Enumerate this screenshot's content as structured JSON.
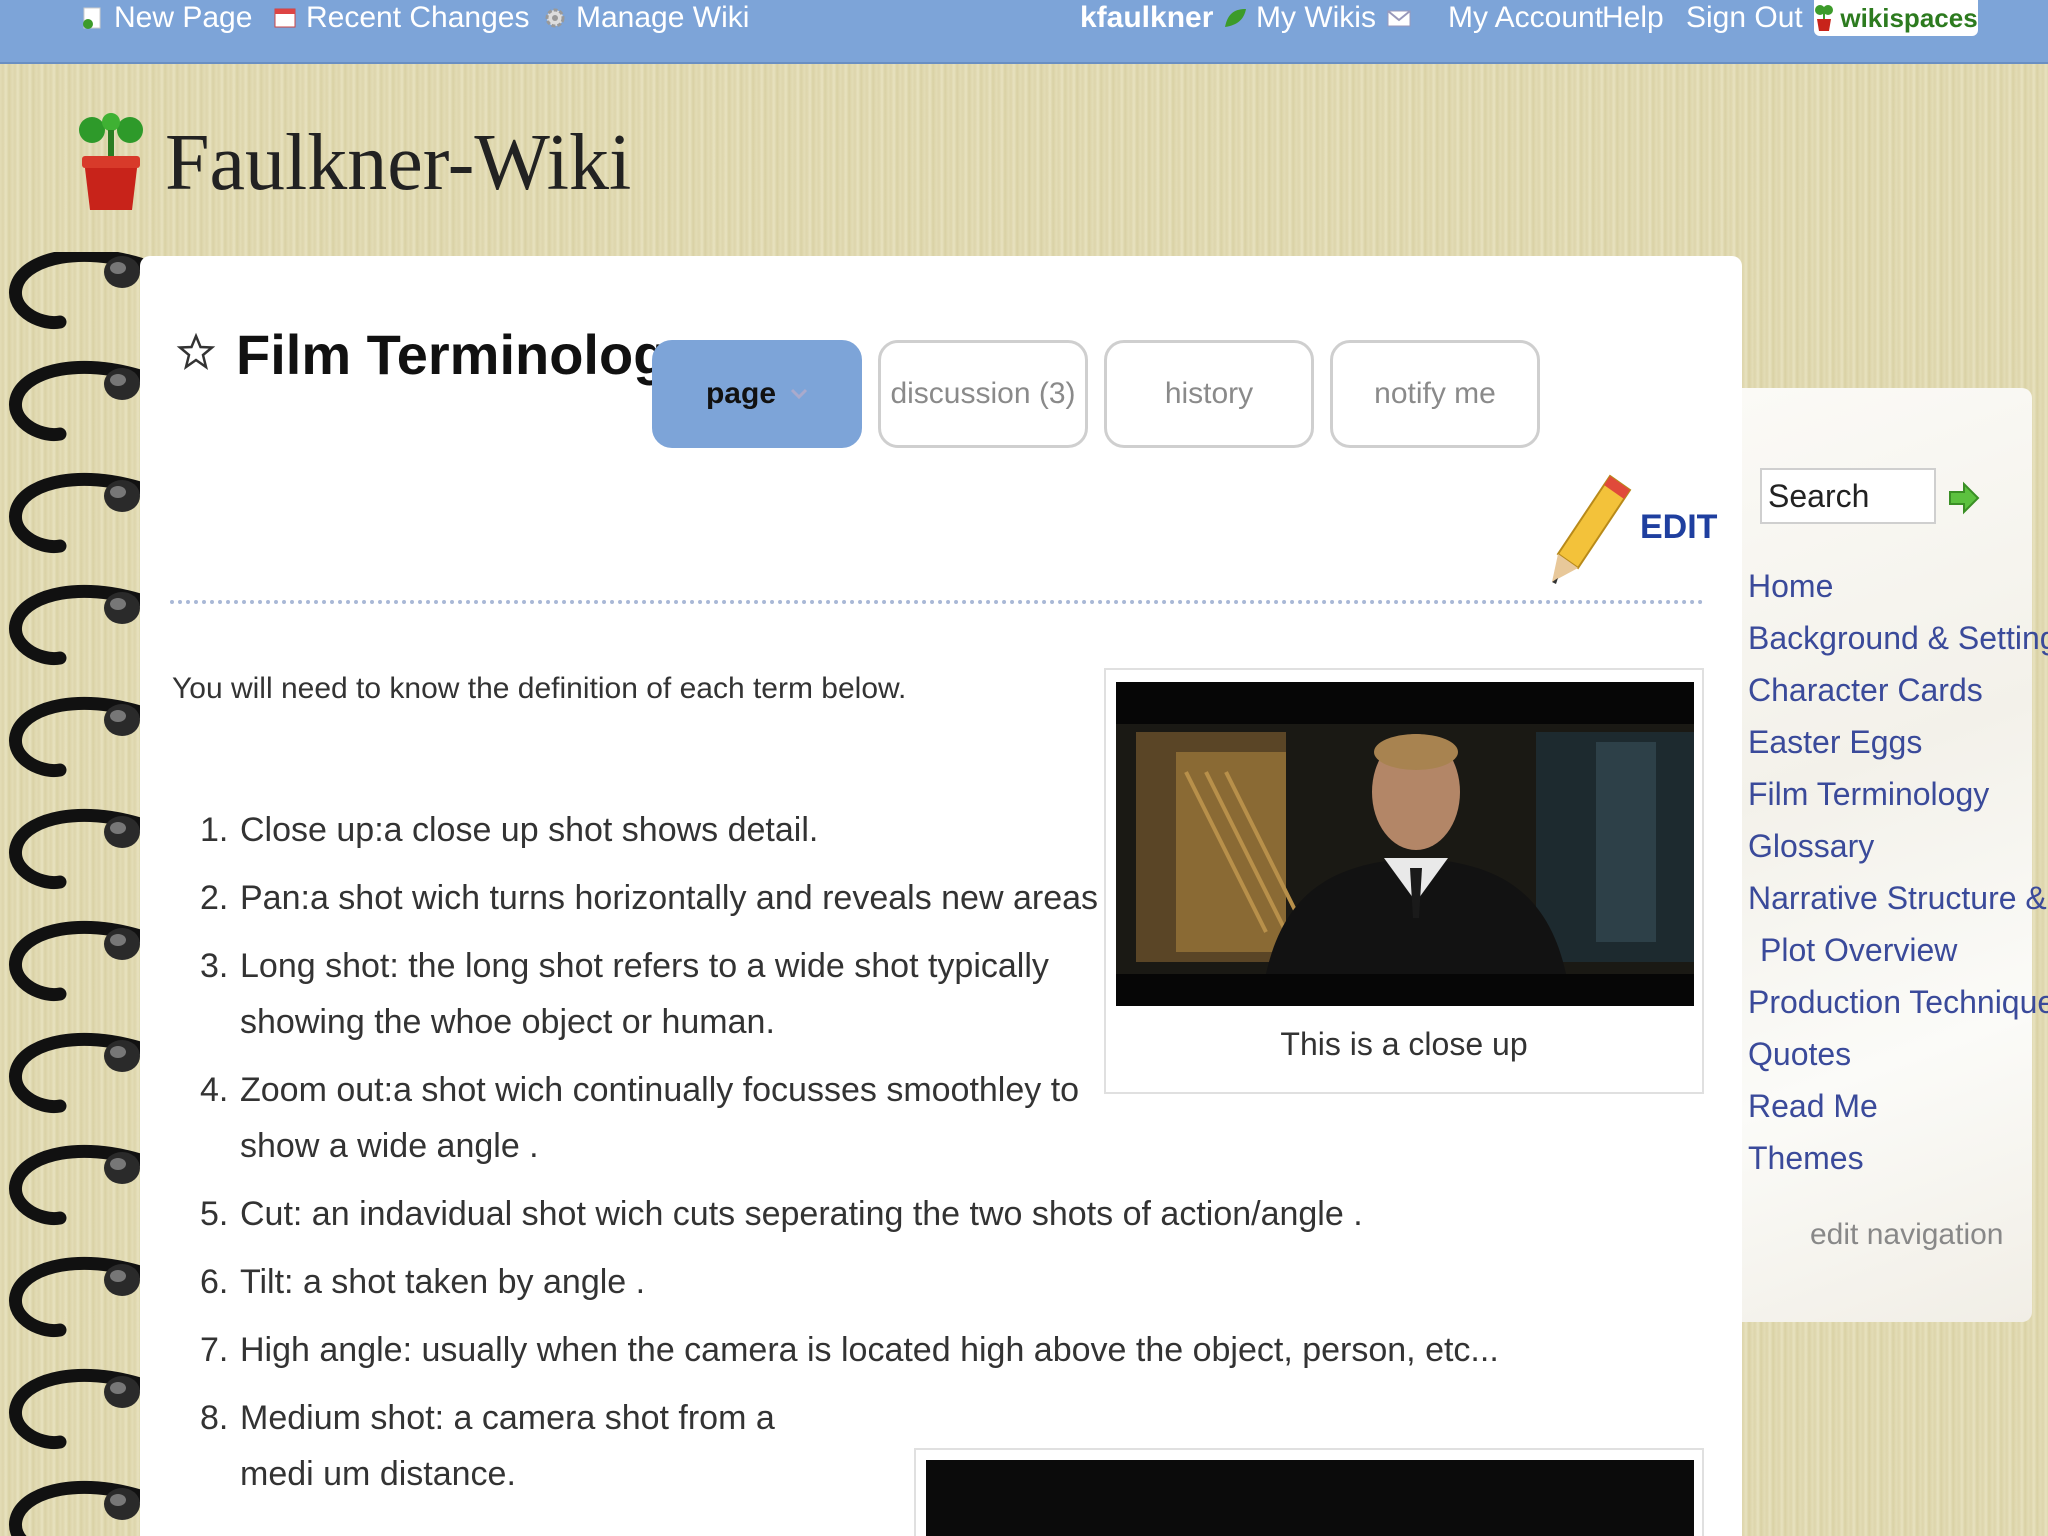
{
  "topbar": {
    "new_page": "New Page",
    "recent_changes": "Recent Changes",
    "manage_wiki": "Manage Wiki",
    "username": "kfaulkner",
    "my_wikis": "My Wikis",
    "my_account": "My Account",
    "help": "Help",
    "sign_out": "Sign Out",
    "brand": "wikispaces"
  },
  "site": {
    "title": "Faulkner-Wiki"
  },
  "page": {
    "title": "Film Terminology",
    "tabs": [
      {
        "label": "page"
      },
      {
        "label": "discussion (3)"
      },
      {
        "label": "history"
      },
      {
        "label": "notify me"
      }
    ],
    "edit_label": "EDIT",
    "intro": "You will need to know the definition of each term below.",
    "terms": [
      {
        "num": "1.",
        "text": "Close up:a close up shot shows detail."
      },
      {
        "num": "2.",
        "text": "Pan:a shot wich turns horizontally and reveals new areas ."
      },
      {
        "num": "3.",
        "text": "Long shot: the long shot refers to a wide shot typically showing the whoe object or human."
      },
      {
        "num": "4.",
        "text": "Zoom out:a shot wich continually focusses smoothley to show a wide angle ."
      },
      {
        "num": "5.",
        "text": "Cut: an indavidual shot wich cuts seperating the two shots of action/angle ."
      },
      {
        "num": "6.",
        "text": "Tilt: a shot taken by angle ."
      },
      {
        "num": "7.",
        "text": "High angle: usually when the camera is located high above the object, person, etc..."
      },
      {
        "num": "8.",
        "text": "Medium shot: a camera shot from a medi um distance."
      }
    ],
    "figure1_caption": "This is a close up"
  },
  "sidebar": {
    "search_value": "Search",
    "nav": [
      {
        "label": "Home"
      },
      {
        "label": "Background & Setting"
      },
      {
        "label": "Character Cards"
      },
      {
        "label": "Easter Eggs"
      },
      {
        "label": "Film Terminology"
      },
      {
        "label": "Glossary"
      },
      {
        "label": "Narrative Structure &"
      },
      {
        "label": "Plot Overview"
      },
      {
        "label": "Production Techniques"
      },
      {
        "label": "Quotes"
      },
      {
        "label": "Read Me"
      },
      {
        "label": "Themes"
      }
    ],
    "edit_navigation": "edit navigation"
  }
}
